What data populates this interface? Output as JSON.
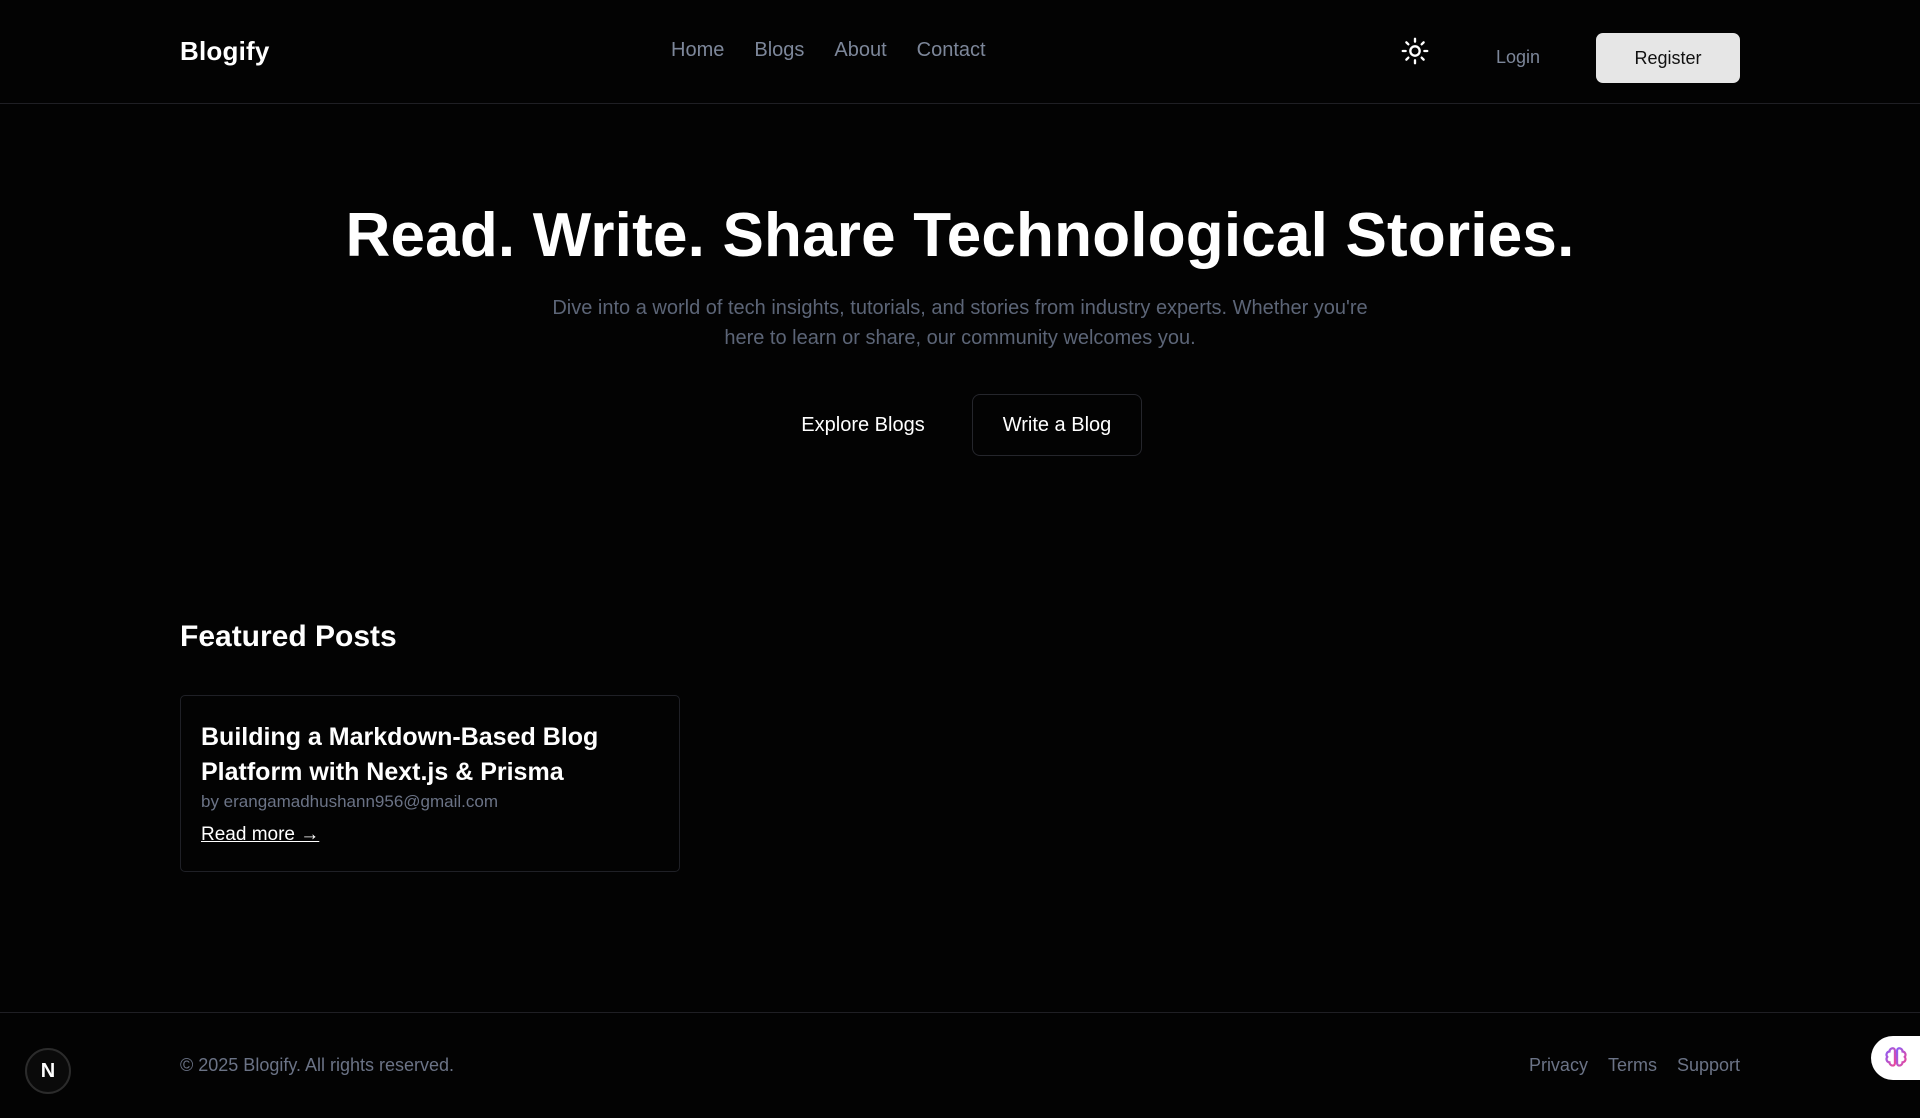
{
  "header": {
    "brand": "Blogify",
    "nav": [
      "Home",
      "Blogs",
      "About",
      "Contact"
    ],
    "theme_icon": "sun-icon",
    "login_label": "Login",
    "register_label": "Register"
  },
  "hero": {
    "title": "Read. Write. Share Technological Stories.",
    "subtitle": "Dive into a world of tech insights, tutorials, and stories from industry experts. Whether you're here to learn or share, our community welcomes you.",
    "primary_cta": "Explore Blogs",
    "secondary_cta": "Write a Blog"
  },
  "featured": {
    "heading": "Featured Posts",
    "posts": [
      {
        "title": "Building a Markdown-Based Blog Platform with Next.js & Prisma",
        "author": "by erangamadhushann956@gmail.com",
        "link_label": "Read more →"
      }
    ]
  },
  "footer": {
    "copyright": "© 2025 Blogify. All rights reserved.",
    "links": [
      "Privacy",
      "Terms",
      "Support"
    ]
  },
  "badges": {
    "next_label": "N",
    "next_icon": "nextjs-icon",
    "extension_icon": "brain-icon"
  },
  "colors": {
    "background": "#030303",
    "muted_text": "#7d879a",
    "register_bg": "#e6e6e6"
  }
}
